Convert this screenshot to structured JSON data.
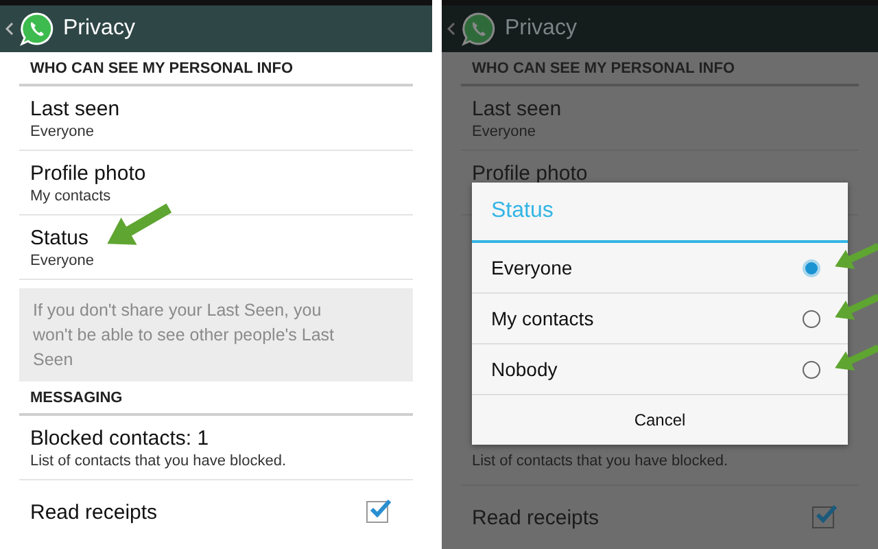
{
  "screens": [
    {
      "dimmed": false,
      "header": {
        "title": "Privacy"
      },
      "top_items": [
        {
          "kind": "section",
          "title": "WHO CAN SEE MY PERSONAL INFO"
        },
        {
          "kind": "row",
          "title": "Last seen",
          "subtitle": "Everyone"
        },
        {
          "kind": "row",
          "title": "Profile photo",
          "subtitle": "My contacts"
        },
        {
          "kind": "row",
          "title": "Status",
          "subtitle": "Everyone"
        },
        {
          "kind": "note",
          "text": "If you don't share your Last Seen, you won't be able to see other people's Last Seen"
        },
        {
          "kind": "section",
          "title": "MESSAGING"
        },
        {
          "kind": "row",
          "title": "Blocked contacts: 1",
          "subtitle": "List of contacts that you have blocked."
        },
        {
          "kind": "check",
          "title": "Read receipts",
          "checked": true
        }
      ]
    },
    {
      "dimmed": true,
      "header": {
        "title": "Privacy"
      },
      "top_items": [
        {
          "kind": "section",
          "title": "WHO CAN SEE MY PERSONAL INFO"
        },
        {
          "kind": "row",
          "title": "Last seen",
          "subtitle": "Everyone"
        },
        {
          "kind": "row",
          "title": "Profile photo"
        }
      ],
      "bottom_items": [
        {
          "kind": "row",
          "subtitle": "List of contacts that you have blocked."
        },
        {
          "kind": "check",
          "title": "Read receipts",
          "checked": true
        }
      ],
      "dialog": {
        "title": "Status",
        "options": [
          {
            "label": "Everyone",
            "selected": true
          },
          {
            "label": "My contacts",
            "selected": false
          },
          {
            "label": "Nobody",
            "selected": false
          }
        ],
        "button": "Cancel"
      }
    }
  ]
}
